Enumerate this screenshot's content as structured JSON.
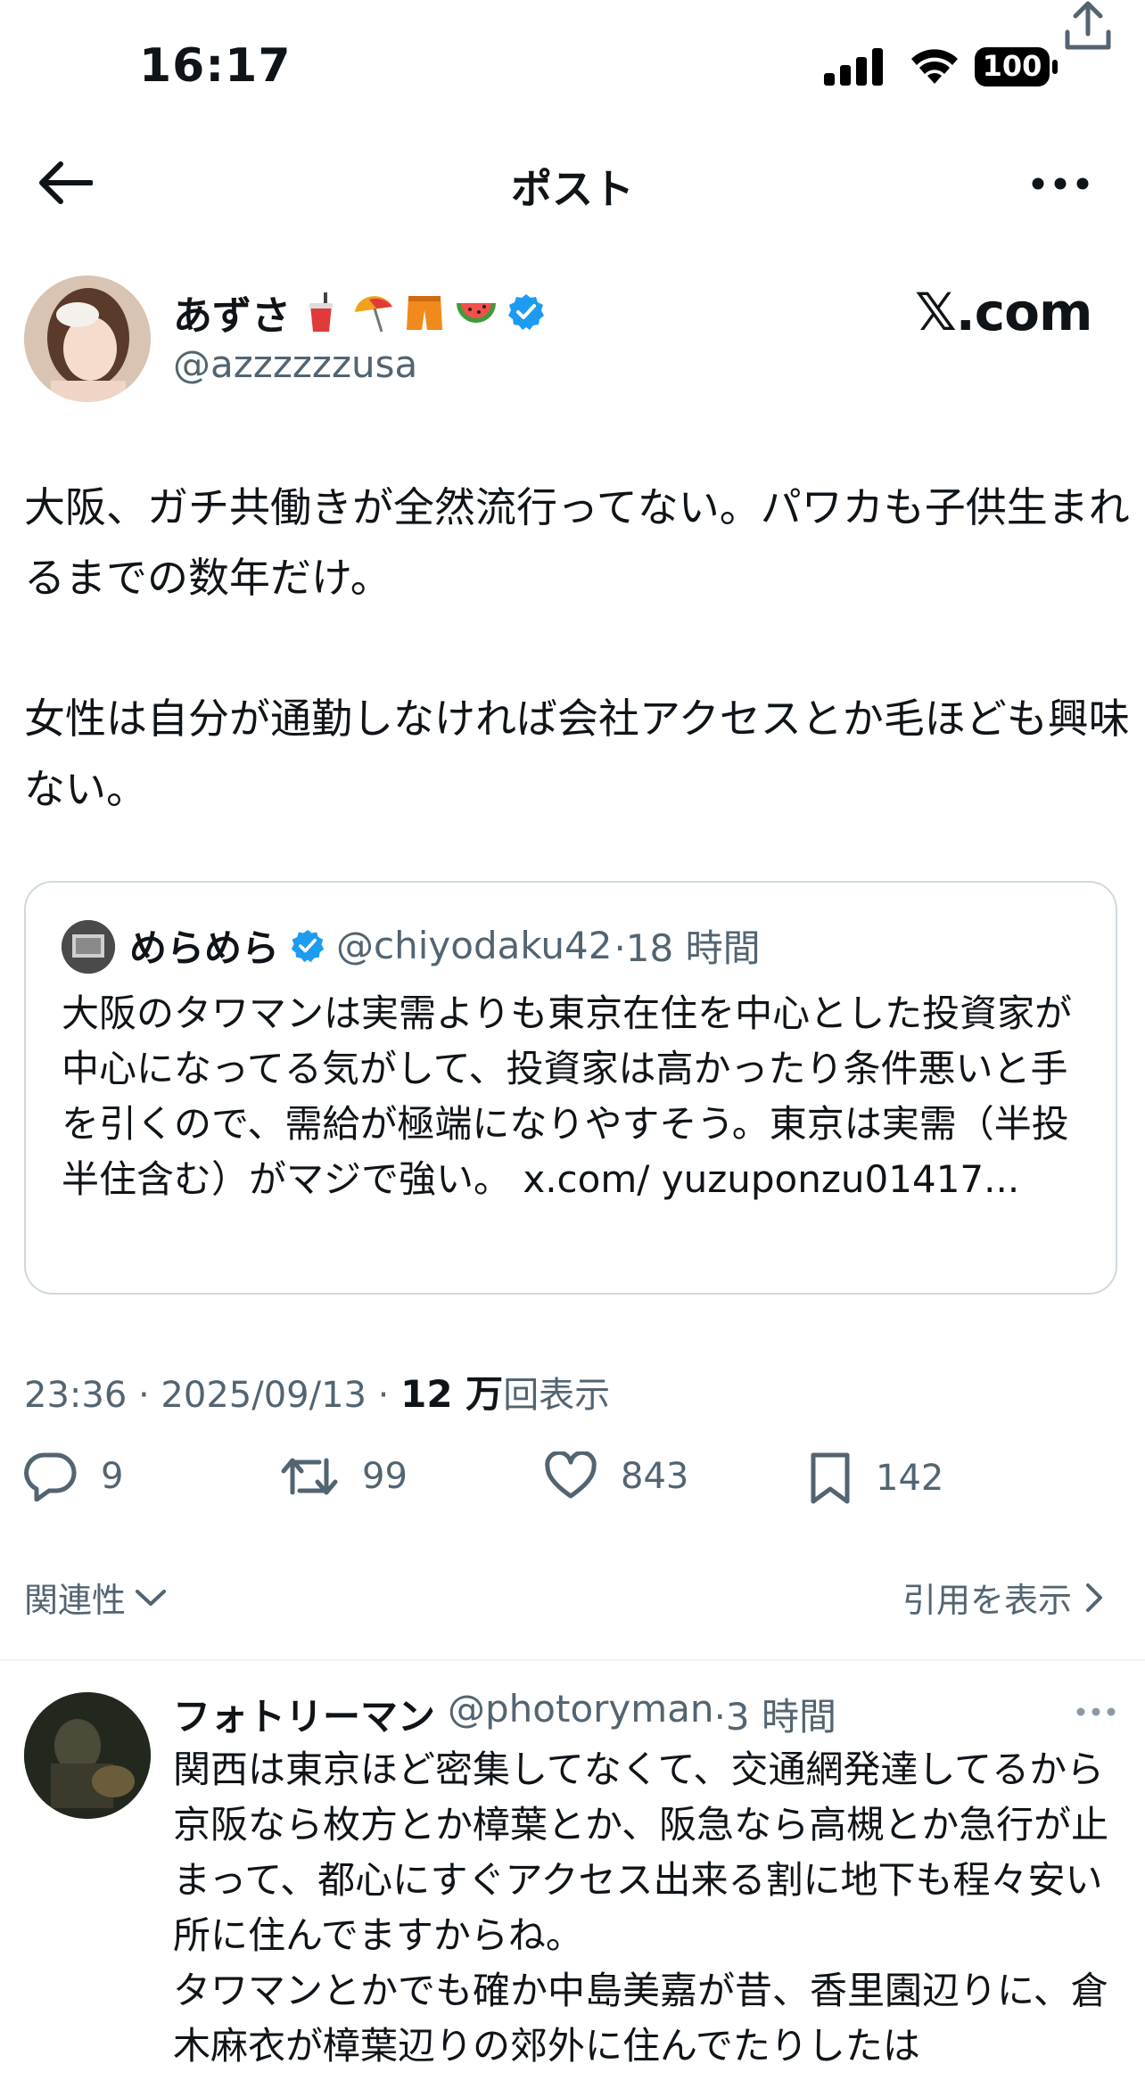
{
  "status_bar": {
    "time": "16:17",
    "battery": "100"
  },
  "header": {
    "title": "ポスト"
  },
  "post": {
    "author_name": "あずさ",
    "handle": "@azzzzzzusa",
    "brand": "𝕏.com",
    "paragraphs": [
      "大阪、ガチ共働きが全然流行ってない。パワカも子供生まれるまでの数年だけ。",
      "女性は自分が通勤しなければ会社アクセスとか毛ほども興味ない。"
    ],
    "quote": {
      "name": "めらめら",
      "handle": "@chiyodaku42",
      "time": "·18 時間",
      "text": "大阪のタワマンは実需よりも東京在住を中心とした投資家が中心になってる気がして、投資家は高かったり条件悪いと手を引くので、需給が極端になりやすそう。東京は実需（半投半住含む）がマジで強い。 x.com/ yuzuponzu01417..."
    },
    "meta": {
      "timestamp": "23:36 · 2025/09/13 · ",
      "views": "12 万",
      "views_label": "回表示"
    },
    "actions": {
      "replies": "9",
      "reposts": "99",
      "likes": "843",
      "bookmarks": "142"
    }
  },
  "sort": {
    "label": "関連性",
    "quotes_link": "引用を表示"
  },
  "reply": {
    "name": "フォトリーマン",
    "handle": "@photoryman",
    "time": "·3 時間",
    "text": "関西は東京ほど密集してなくて、交通網発達してるから\n京阪なら枚方とか樟葉とか、阪急なら高槻とか急行が止まって、都心にすぐアクセス出来る割に地下も程々安い所に住んでますからね。\nタワマンとかでも確か中島美嘉が昔、香里園辺りに、倉木麻衣が樟葉辺りの郊外に住んでたりしたは"
  },
  "colors": {
    "text": "#0f1419",
    "muted": "#536471",
    "verified": "#1d9bf0",
    "border": "#cfd9de"
  }
}
